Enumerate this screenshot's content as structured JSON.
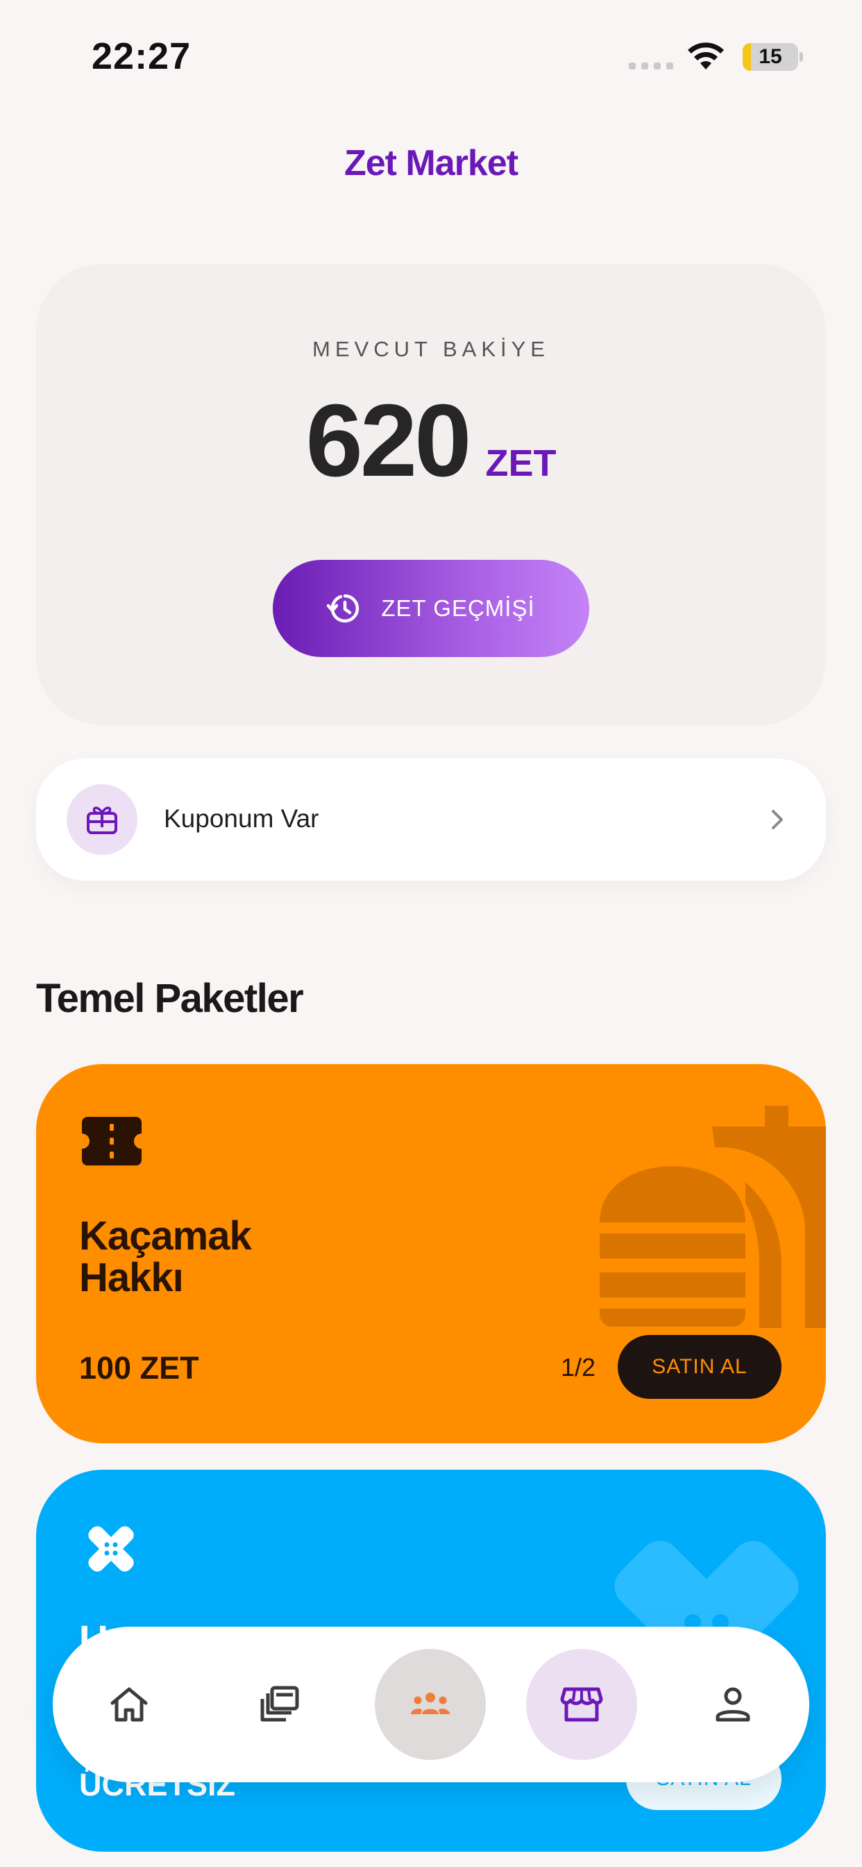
{
  "status_bar": {
    "time": "22:27",
    "battery": "15",
    "battery_level": 0.15
  },
  "header": {
    "title": "Zet Market"
  },
  "balance": {
    "label": "MEVCUT BAKİYE",
    "value": "620",
    "unit": "ZET",
    "history_button": "ZET GEÇMİŞİ"
  },
  "coupon": {
    "label": "Kuponum Var"
  },
  "section": {
    "title": "Temel Paketler"
  },
  "packages": [
    {
      "title_line1": "Kaçamak",
      "title_line2": "Hakkı",
      "price": "100 ZET",
      "quota": "1/2",
      "buy_label": "SATIN AL",
      "color": "#fe8e00",
      "icon": "ticket-icon",
      "bg_icon": "burger-drink-icon"
    },
    {
      "title_line1": "U",
      "price": "ÜCRETSİZ",
      "buy_label": "SATIN AL",
      "color": "#00adfa",
      "icon": "bandage-icon",
      "bg_icon": "bandage-icon"
    }
  ],
  "bottom_nav": {
    "items": [
      "home-icon",
      "cards-icon",
      "community-icon",
      "store-icon",
      "profile-icon"
    ],
    "active": "store-icon",
    "accent": "#6a19b8",
    "community_color": "#ef7d3c"
  }
}
